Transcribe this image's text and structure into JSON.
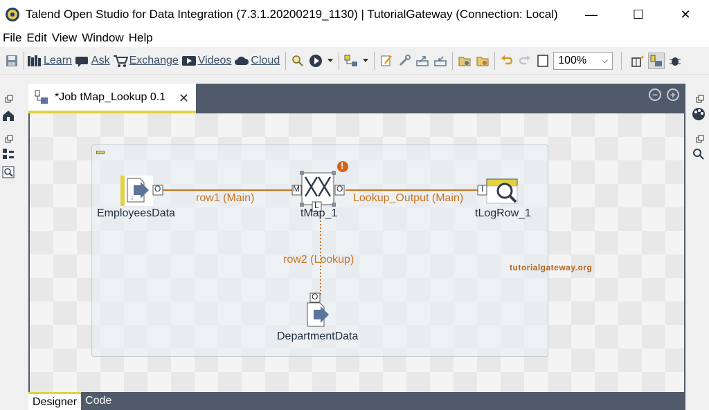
{
  "window": {
    "title": "Talend Open Studio for Data Integration (7.3.1.20200219_1130) | TutorialGateway (Connection: Local)",
    "controls": {
      "minimize": "—",
      "maximize": "☐",
      "close": "✕"
    }
  },
  "menu": [
    "File",
    "Edit",
    "View",
    "Window",
    "Help"
  ],
  "toolbar": {
    "links": [
      {
        "label": "Learn",
        "icon": "book-icon"
      },
      {
        "label": "Ask",
        "icon": "chat-icon"
      },
      {
        "label": "Exchange",
        "icon": "cart-icon"
      },
      {
        "label": "Videos",
        "icon": "video-icon"
      },
      {
        "label": "Cloud",
        "icon": "cloud-icon"
      }
    ],
    "zoom": "100%"
  },
  "editor": {
    "tab_title": "*Job tMap_Lookup 0.1",
    "tab_close": "✕",
    "bottom_tabs": [
      "Designer",
      "Code"
    ]
  },
  "canvas": {
    "components": {
      "employees": "EmployeesData",
      "tmap": "tMap_1",
      "logrow": "tLogRow_1",
      "department": "DepartmentData"
    },
    "links": {
      "row1": "row1 (Main)",
      "lookup_output": "Lookup_Output (Main)",
      "row2": "row2 (Lookup)"
    },
    "ports": {
      "out": "O",
      "main": "M",
      "lookup": "L",
      "in": "I"
    },
    "warning_badge": "!",
    "watermark": "tutorialgateway.org"
  },
  "colors": {
    "tab_accent": "#e2d240",
    "link_color": "#c8731f",
    "editor_frame": "#505a6a"
  }
}
